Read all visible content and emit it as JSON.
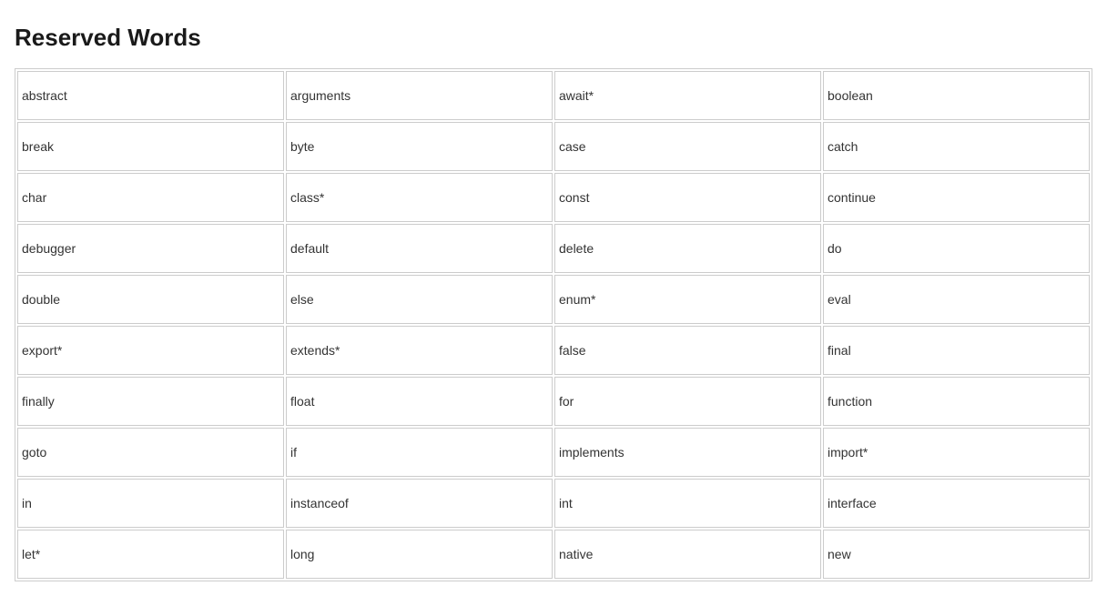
{
  "heading": "Reserved Words",
  "rows": [
    [
      "abstract",
      "arguments",
      "await*",
      "boolean"
    ],
    [
      "break",
      "byte",
      "case",
      "catch"
    ],
    [
      "char",
      "class*",
      "const",
      "continue"
    ],
    [
      "debugger",
      "default",
      "delete",
      "do"
    ],
    [
      "double",
      "else",
      "enum*",
      "eval"
    ],
    [
      "export*",
      "extends*",
      "false",
      "final"
    ],
    [
      "finally",
      "float",
      "for",
      "function"
    ],
    [
      "goto",
      "if",
      "implements",
      "import*"
    ],
    [
      "in",
      "instanceof",
      "int",
      "interface"
    ],
    [
      "let*",
      "long",
      "native",
      "new"
    ]
  ]
}
